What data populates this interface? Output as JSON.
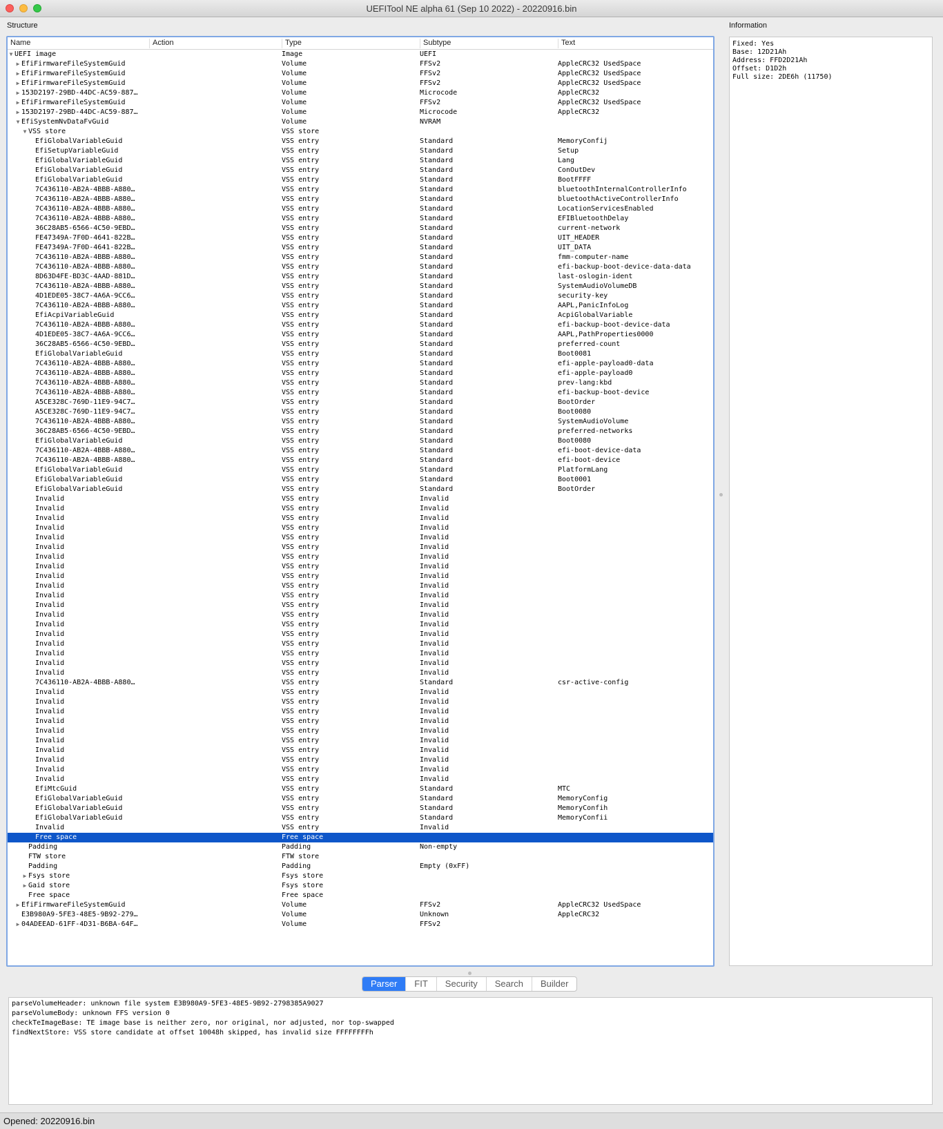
{
  "window": {
    "title": "UEFITool NE alpha 61 (Sep 10 2022) - 20220916.bin"
  },
  "panels": {
    "structure": "Structure",
    "information": "Information"
  },
  "columns": [
    "Name",
    "Action",
    "Type",
    "Subtype",
    "Text"
  ],
  "rows": [
    {
      "d": 0,
      "e": "o",
      "n": "UEFI image",
      "t": "Image",
      "s": "UEFI",
      "x": ""
    },
    {
      "d": 1,
      "e": "c",
      "n": "EfiFirmwareFileSystemGuid",
      "t": "Volume",
      "s": "FFSv2",
      "x": "AppleCRC32 UsedSpace"
    },
    {
      "d": 1,
      "e": "c",
      "n": "EfiFirmwareFileSystemGuid",
      "t": "Volume",
      "s": "FFSv2",
      "x": "AppleCRC32 UsedSpace"
    },
    {
      "d": 1,
      "e": "c",
      "n": "EfiFirmwareFileSystemGuid",
      "t": "Volume",
      "s": "FFSv2",
      "x": "AppleCRC32 UsedSpace"
    },
    {
      "d": 1,
      "e": "c",
      "n": "153D2197-29BD-44DC-AC59-887…",
      "t": "Volume",
      "s": "Microcode",
      "x": "AppleCRC32"
    },
    {
      "d": 1,
      "e": "c",
      "n": "EfiFirmwareFileSystemGuid",
      "t": "Volume",
      "s": "FFSv2",
      "x": "AppleCRC32 UsedSpace"
    },
    {
      "d": 1,
      "e": "c",
      "n": "153D2197-29BD-44DC-AC59-887…",
      "t": "Volume",
      "s": "Microcode",
      "x": "AppleCRC32"
    },
    {
      "d": 1,
      "e": "o",
      "n": "EfiSystemNvDataFvGuid",
      "t": "Volume",
      "s": "NVRAM",
      "x": ""
    },
    {
      "d": 2,
      "e": "o",
      "n": "VSS store",
      "t": "VSS store",
      "s": "",
      "x": ""
    },
    {
      "d": 3,
      "e": "",
      "n": "EfiGlobalVariableGuid",
      "t": "VSS entry",
      "s": "Standard",
      "x": "MemoryConfij"
    },
    {
      "d": 3,
      "e": "",
      "n": "EfiSetupVariableGuid",
      "t": "VSS entry",
      "s": "Standard",
      "x": "Setup"
    },
    {
      "d": 3,
      "e": "",
      "n": "EfiGlobalVariableGuid",
      "t": "VSS entry",
      "s": "Standard",
      "x": "Lang"
    },
    {
      "d": 3,
      "e": "",
      "n": "EfiGlobalVariableGuid",
      "t": "VSS entry",
      "s": "Standard",
      "x": "ConOutDev"
    },
    {
      "d": 3,
      "e": "",
      "n": "EfiGlobalVariableGuid",
      "t": "VSS entry",
      "s": "Standard",
      "x": "BootFFFF"
    },
    {
      "d": 3,
      "e": "",
      "n": "7C436110-AB2A-4BBB-A880…",
      "t": "VSS entry",
      "s": "Standard",
      "x": "bluetoothInternalControllerInfo"
    },
    {
      "d": 3,
      "e": "",
      "n": "7C436110-AB2A-4BBB-A880…",
      "t": "VSS entry",
      "s": "Standard",
      "x": "bluetoothActiveControllerInfo"
    },
    {
      "d": 3,
      "e": "",
      "n": "7C436110-AB2A-4BBB-A880…",
      "t": "VSS entry",
      "s": "Standard",
      "x": "LocationServicesEnabled"
    },
    {
      "d": 3,
      "e": "",
      "n": "7C436110-AB2A-4BBB-A880…",
      "t": "VSS entry",
      "s": "Standard",
      "x": "EFIBluetoothDelay"
    },
    {
      "d": 3,
      "e": "",
      "n": "36C28AB5-6566-4C50-9EBD…",
      "t": "VSS entry",
      "s": "Standard",
      "x": "current-network"
    },
    {
      "d": 3,
      "e": "",
      "n": "FE47349A-7F0D-4641-822B…",
      "t": "VSS entry",
      "s": "Standard",
      "x": "UIT_HEADER"
    },
    {
      "d": 3,
      "e": "",
      "n": "FE47349A-7F0D-4641-822B…",
      "t": "VSS entry",
      "s": "Standard",
      "x": "UIT_DATA"
    },
    {
      "d": 3,
      "e": "",
      "n": "7C436110-AB2A-4BBB-A880…",
      "t": "VSS entry",
      "s": "Standard",
      "x": "fmm-computer-name"
    },
    {
      "d": 3,
      "e": "",
      "n": "7C436110-AB2A-4BBB-A880…",
      "t": "VSS entry",
      "s": "Standard",
      "x": "efi-backup-boot-device-data-data"
    },
    {
      "d": 3,
      "e": "",
      "n": "8D63D4FE-BD3C-4AAD-881D…",
      "t": "VSS entry",
      "s": "Standard",
      "x": "last-oslogin-ident"
    },
    {
      "d": 3,
      "e": "",
      "n": "7C436110-AB2A-4BBB-A880…",
      "t": "VSS entry",
      "s": "Standard",
      "x": "SystemAudioVolumeDB"
    },
    {
      "d": 3,
      "e": "",
      "n": "4D1EDE05-38C7-4A6A-9CC6…",
      "t": "VSS entry",
      "s": "Standard",
      "x": "security-key"
    },
    {
      "d": 3,
      "e": "",
      "n": "7C436110-AB2A-4BBB-A880…",
      "t": "VSS entry",
      "s": "Standard",
      "x": "AAPL,PanicInfoLog"
    },
    {
      "d": 3,
      "e": "",
      "n": "EfiAcpiVariableGuid",
      "t": "VSS entry",
      "s": "Standard",
      "x": "AcpiGlobalVariable"
    },
    {
      "d": 3,
      "e": "",
      "n": "7C436110-AB2A-4BBB-A880…",
      "t": "VSS entry",
      "s": "Standard",
      "x": "efi-backup-boot-device-data"
    },
    {
      "d": 3,
      "e": "",
      "n": "4D1EDE05-38C7-4A6A-9CC6…",
      "t": "VSS entry",
      "s": "Standard",
      "x": "AAPL,PathProperties0000"
    },
    {
      "d": 3,
      "e": "",
      "n": "36C28AB5-6566-4C50-9EBD…",
      "t": "VSS entry",
      "s": "Standard",
      "x": "preferred-count"
    },
    {
      "d": 3,
      "e": "",
      "n": "EfiGlobalVariableGuid",
      "t": "VSS entry",
      "s": "Standard",
      "x": "Boot0081"
    },
    {
      "d": 3,
      "e": "",
      "n": "7C436110-AB2A-4BBB-A880…",
      "t": "VSS entry",
      "s": "Standard",
      "x": "efi-apple-payload0-data"
    },
    {
      "d": 3,
      "e": "",
      "n": "7C436110-AB2A-4BBB-A880…",
      "t": "VSS entry",
      "s": "Standard",
      "x": "efi-apple-payload0"
    },
    {
      "d": 3,
      "e": "",
      "n": "7C436110-AB2A-4BBB-A880…",
      "t": "VSS entry",
      "s": "Standard",
      "x": "prev-lang:kbd"
    },
    {
      "d": 3,
      "e": "",
      "n": "7C436110-AB2A-4BBB-A880…",
      "t": "VSS entry",
      "s": "Standard",
      "x": "efi-backup-boot-device"
    },
    {
      "d": 3,
      "e": "",
      "n": "A5CE328C-769D-11E9-94C7…",
      "t": "VSS entry",
      "s": "Standard",
      "x": "BootOrder"
    },
    {
      "d": 3,
      "e": "",
      "n": "A5CE328C-769D-11E9-94C7…",
      "t": "VSS entry",
      "s": "Standard",
      "x": "Boot0080"
    },
    {
      "d": 3,
      "e": "",
      "n": "7C436110-AB2A-4BBB-A880…",
      "t": "VSS entry",
      "s": "Standard",
      "x": "SystemAudioVolume"
    },
    {
      "d": 3,
      "e": "",
      "n": "36C28AB5-6566-4C50-9EBD…",
      "t": "VSS entry",
      "s": "Standard",
      "x": "preferred-networks"
    },
    {
      "d": 3,
      "e": "",
      "n": "EfiGlobalVariableGuid",
      "t": "VSS entry",
      "s": "Standard",
      "x": "Boot0080"
    },
    {
      "d": 3,
      "e": "",
      "n": "7C436110-AB2A-4BBB-A880…",
      "t": "VSS entry",
      "s": "Standard",
      "x": "efi-boot-device-data"
    },
    {
      "d": 3,
      "e": "",
      "n": "7C436110-AB2A-4BBB-A880…",
      "t": "VSS entry",
      "s": "Standard",
      "x": "efi-boot-device"
    },
    {
      "d": 3,
      "e": "",
      "n": "EfiGlobalVariableGuid",
      "t": "VSS entry",
      "s": "Standard",
      "x": "PlatformLang"
    },
    {
      "d": 3,
      "e": "",
      "n": "EfiGlobalVariableGuid",
      "t": "VSS entry",
      "s": "Standard",
      "x": "Boot0001"
    },
    {
      "d": 3,
      "e": "",
      "n": "EfiGlobalVariableGuid",
      "t": "VSS entry",
      "s": "Standard",
      "x": "BootOrder"
    },
    {
      "d": 3,
      "e": "",
      "n": "Invalid",
      "t": "VSS entry",
      "s": "Invalid",
      "x": ""
    },
    {
      "d": 3,
      "e": "",
      "n": "Invalid",
      "t": "VSS entry",
      "s": "Invalid",
      "x": ""
    },
    {
      "d": 3,
      "e": "",
      "n": "Invalid",
      "t": "VSS entry",
      "s": "Invalid",
      "x": ""
    },
    {
      "d": 3,
      "e": "",
      "n": "Invalid",
      "t": "VSS entry",
      "s": "Invalid",
      "x": ""
    },
    {
      "d": 3,
      "e": "",
      "n": "Invalid",
      "t": "VSS entry",
      "s": "Invalid",
      "x": ""
    },
    {
      "d": 3,
      "e": "",
      "n": "Invalid",
      "t": "VSS entry",
      "s": "Invalid",
      "x": ""
    },
    {
      "d": 3,
      "e": "",
      "n": "Invalid",
      "t": "VSS entry",
      "s": "Invalid",
      "x": ""
    },
    {
      "d": 3,
      "e": "",
      "n": "Invalid",
      "t": "VSS entry",
      "s": "Invalid",
      "x": ""
    },
    {
      "d": 3,
      "e": "",
      "n": "Invalid",
      "t": "VSS entry",
      "s": "Invalid",
      "x": ""
    },
    {
      "d": 3,
      "e": "",
      "n": "Invalid",
      "t": "VSS entry",
      "s": "Invalid",
      "x": ""
    },
    {
      "d": 3,
      "e": "",
      "n": "Invalid",
      "t": "VSS entry",
      "s": "Invalid",
      "x": ""
    },
    {
      "d": 3,
      "e": "",
      "n": "Invalid",
      "t": "VSS entry",
      "s": "Invalid",
      "x": ""
    },
    {
      "d": 3,
      "e": "",
      "n": "Invalid",
      "t": "VSS entry",
      "s": "Invalid",
      "x": ""
    },
    {
      "d": 3,
      "e": "",
      "n": "Invalid",
      "t": "VSS entry",
      "s": "Invalid",
      "x": ""
    },
    {
      "d": 3,
      "e": "",
      "n": "Invalid",
      "t": "VSS entry",
      "s": "Invalid",
      "x": ""
    },
    {
      "d": 3,
      "e": "",
      "n": "Invalid",
      "t": "VSS entry",
      "s": "Invalid",
      "x": ""
    },
    {
      "d": 3,
      "e": "",
      "n": "Invalid",
      "t": "VSS entry",
      "s": "Invalid",
      "x": ""
    },
    {
      "d": 3,
      "e": "",
      "n": "Invalid",
      "t": "VSS entry",
      "s": "Invalid",
      "x": ""
    },
    {
      "d": 3,
      "e": "",
      "n": "Invalid",
      "t": "VSS entry",
      "s": "Invalid",
      "x": ""
    },
    {
      "d": 3,
      "e": "",
      "n": "7C436110-AB2A-4BBB-A880…",
      "t": "VSS entry",
      "s": "Standard",
      "x": "csr-active-config"
    },
    {
      "d": 3,
      "e": "",
      "n": "Invalid",
      "t": "VSS entry",
      "s": "Invalid",
      "x": ""
    },
    {
      "d": 3,
      "e": "",
      "n": "Invalid",
      "t": "VSS entry",
      "s": "Invalid",
      "x": ""
    },
    {
      "d": 3,
      "e": "",
      "n": "Invalid",
      "t": "VSS entry",
      "s": "Invalid",
      "x": ""
    },
    {
      "d": 3,
      "e": "",
      "n": "Invalid",
      "t": "VSS entry",
      "s": "Invalid",
      "x": ""
    },
    {
      "d": 3,
      "e": "",
      "n": "Invalid",
      "t": "VSS entry",
      "s": "Invalid",
      "x": ""
    },
    {
      "d": 3,
      "e": "",
      "n": "Invalid",
      "t": "VSS entry",
      "s": "Invalid",
      "x": ""
    },
    {
      "d": 3,
      "e": "",
      "n": "Invalid",
      "t": "VSS entry",
      "s": "Invalid",
      "x": ""
    },
    {
      "d": 3,
      "e": "",
      "n": "Invalid",
      "t": "VSS entry",
      "s": "Invalid",
      "x": ""
    },
    {
      "d": 3,
      "e": "",
      "n": "Invalid",
      "t": "VSS entry",
      "s": "Invalid",
      "x": ""
    },
    {
      "d": 3,
      "e": "",
      "n": "Invalid",
      "t": "VSS entry",
      "s": "Invalid",
      "x": ""
    },
    {
      "d": 3,
      "e": "",
      "n": "EfiMtcGuid",
      "t": "VSS entry",
      "s": "Standard",
      "x": "MTC"
    },
    {
      "d": 3,
      "e": "",
      "n": "EfiGlobalVariableGuid",
      "t": "VSS entry",
      "s": "Standard",
      "x": "MemoryConfig"
    },
    {
      "d": 3,
      "e": "",
      "n": "EfiGlobalVariableGuid",
      "t": "VSS entry",
      "s": "Standard",
      "x": "MemoryConfih"
    },
    {
      "d": 3,
      "e": "",
      "n": "EfiGlobalVariableGuid",
      "t": "VSS entry",
      "s": "Standard",
      "x": "MemoryConfii"
    },
    {
      "d": 3,
      "e": "",
      "n": "Invalid",
      "t": "VSS entry",
      "s": "Invalid",
      "x": ""
    },
    {
      "d": 3,
      "e": "",
      "n": "Free space",
      "t": "Free space",
      "s": "",
      "x": "",
      "sel": true
    },
    {
      "d": 2,
      "e": "",
      "n": "Padding",
      "t": "Padding",
      "s": "Non-empty",
      "x": ""
    },
    {
      "d": 2,
      "e": "",
      "n": "FTW store",
      "t": "FTW store",
      "s": "",
      "x": ""
    },
    {
      "d": 2,
      "e": "",
      "n": "Padding",
      "t": "Padding",
      "s": "Empty (0xFF)",
      "x": ""
    },
    {
      "d": 2,
      "e": "c",
      "n": "Fsys store",
      "t": "Fsys store",
      "s": "",
      "x": ""
    },
    {
      "d": 2,
      "e": "c",
      "n": "Gaid store",
      "t": "Fsys store",
      "s": "",
      "x": ""
    },
    {
      "d": 2,
      "e": "",
      "n": "Free space",
      "t": "Free space",
      "s": "",
      "x": ""
    },
    {
      "d": 1,
      "e": "c",
      "n": "EfiFirmwareFileSystemGuid",
      "t": "Volume",
      "s": "FFSv2",
      "x": "AppleCRC32 UsedSpace"
    },
    {
      "d": 1,
      "e": "",
      "n": "E3B980A9-5FE3-48E5-9B92-279…",
      "t": "Volume",
      "s": "Unknown",
      "x": "AppleCRC32"
    },
    {
      "d": 1,
      "e": "c",
      "n": "04ADEEAD-61FF-4D31-B6BA-64F…",
      "t": "Volume",
      "s": "FFSv2",
      "x": ""
    }
  ],
  "info": [
    "Fixed: Yes",
    "Base: 12D21Ah",
    "Address: FFD2D21Ah",
    "Offset: D1D2h",
    "Full size: 2DE6h (11750)"
  ],
  "tabs": [
    "Parser",
    "FIT",
    "Security",
    "Search",
    "Builder"
  ],
  "active_tab": "Parser",
  "messages": [
    "parseVolumeHeader: unknown file system E3B980A9-5FE3-48E5-9B92-2798385A9027",
    "parseVolumeBody: unknown FFS version 0",
    "checkTeImageBase: TE image base is neither zero, nor original, nor adjusted, nor top-swapped",
    "findNextStore: VSS store candidate at offset 10048h skipped, has invalid size FFFFFFFFh"
  ],
  "status": "Opened: 20220916.bin",
  "colors": {
    "selection": "#0e56c9",
    "focus_border": "#7fa7e4",
    "active_tab": "#2f7cf6"
  },
  "icons": {
    "collapsed": "triangle-right-icon",
    "expanded": "triangle-down-icon"
  }
}
